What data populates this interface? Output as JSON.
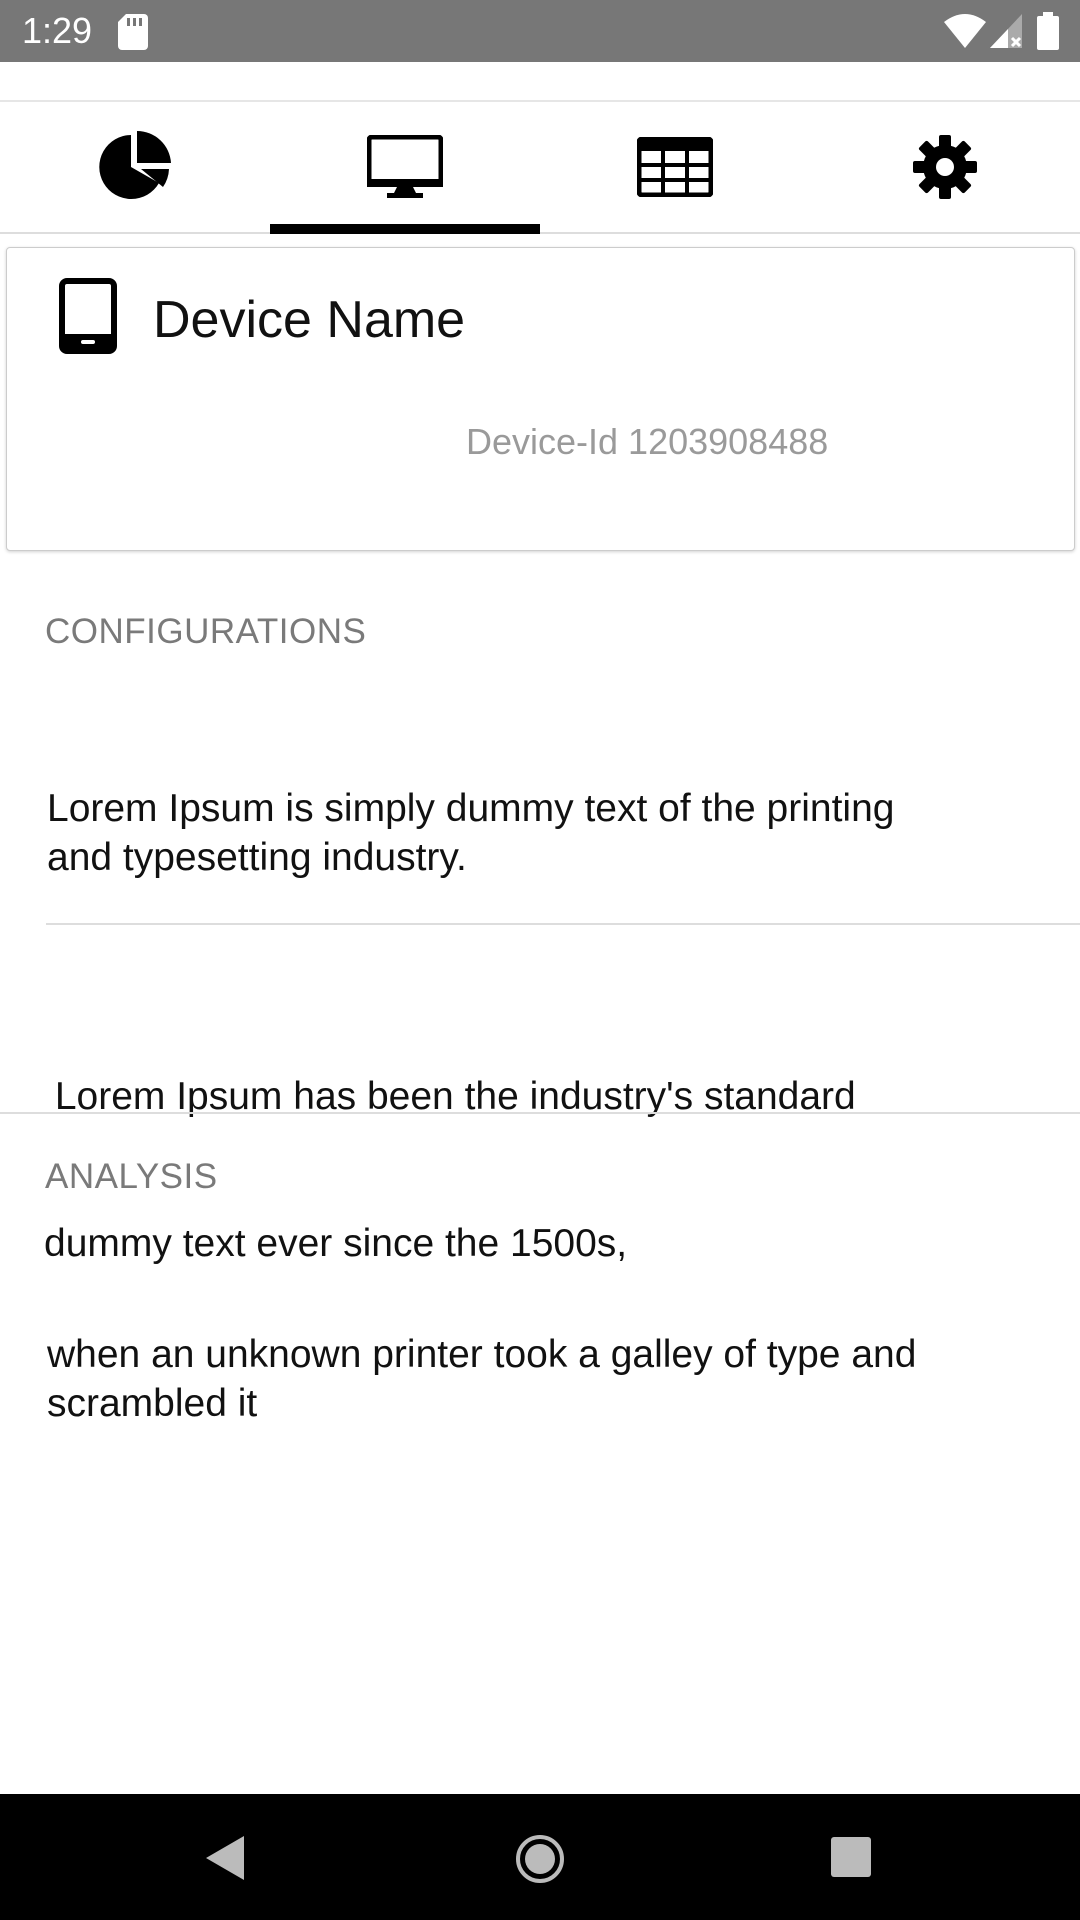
{
  "status_bar": {
    "time": "1:29",
    "icons": [
      "sd-card-icon",
      "wifi-icon",
      "signal-icon",
      "battery-icon"
    ]
  },
  "tabs": [
    {
      "icon": "pie-chart-icon",
      "selected": false
    },
    {
      "icon": "monitor-icon",
      "selected": true
    },
    {
      "icon": "table-icon",
      "selected": false
    },
    {
      "icon": "gear-icon",
      "selected": false
    }
  ],
  "device": {
    "icon": "tablet-icon",
    "name": "Device Name",
    "id_text": "Device-Id 1203908488"
  },
  "sections": {
    "configurations": {
      "header": "CONFIGURATIONS",
      "items": [
        {
          "line1": "Lorem Ipsum is simply dummy text of the printing",
          "line2": "and typesetting industry."
        },
        {
          "line1": " Lorem Ipsum has been the industry's standard",
          "line2": "dummy text ever since the 1500s,"
        }
      ]
    },
    "analysis": {
      "header": "ANALYSIS",
      "items": [
        {
          "line1": "when an unknown printer took a galley of type and",
          "line2": "scrambled it"
        }
      ]
    }
  },
  "nav_bar": {
    "buttons": [
      "back-icon",
      "home-icon",
      "recents-icon"
    ]
  },
  "colors": {
    "status_bar": "#777777",
    "nav_bar": "#000000",
    "tab_indicator": "#000000",
    "secondary_text": "#9a9a9a",
    "section_header": "#7a7a7a"
  }
}
